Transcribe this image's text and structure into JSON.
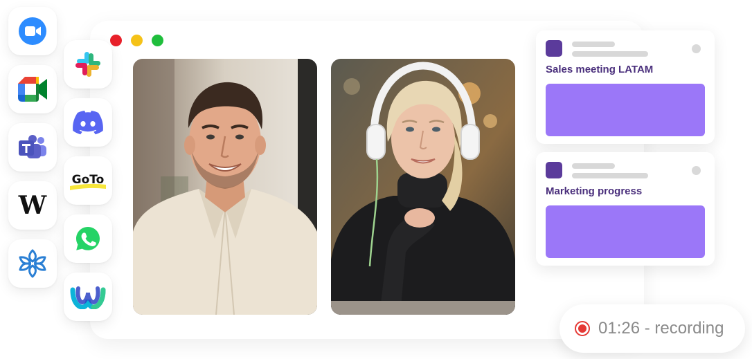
{
  "apps_left": [
    {
      "name": "Zoom",
      "icon": "zoom-icon",
      "color": "#2d8cff"
    },
    {
      "name": "Google Meet",
      "icon": "google-meet-icon",
      "color": "#00832d"
    },
    {
      "name": "Microsoft Teams",
      "icon": "microsoft-teams-icon",
      "color": "#5b5fc7"
    },
    {
      "name": "Webex Calling",
      "icon": "w-letter-icon",
      "color": "#111111"
    },
    {
      "name": "Zoho",
      "icon": "asterisk-icon",
      "color": "#2a7fd4"
    }
  ],
  "apps_right": [
    {
      "name": "Slack",
      "icon": "slack-icon",
      "color": "#e01e5a"
    },
    {
      "name": "Discord",
      "icon": "discord-icon",
      "color": "#5865f2"
    },
    {
      "name": "GoTo",
      "icon": "goto-icon",
      "label": "GoTo",
      "color": "#f7e63a"
    },
    {
      "name": "WhatsApp",
      "icon": "whatsapp-icon",
      "color": "#25d366"
    },
    {
      "name": "Webex",
      "icon": "webex-icon",
      "color": "#07a3c8"
    }
  ],
  "window": {
    "dots": [
      {
        "name": "close",
        "color": "#e8202a"
      },
      {
        "name": "minimize",
        "color": "#f5c218"
      },
      {
        "name": "maximize",
        "color": "#1fbe3c"
      }
    ]
  },
  "participants": [
    {
      "name": "man-in-linen-shirt"
    },
    {
      "name": "woman-with-headphones"
    }
  ],
  "meetings": [
    {
      "title": "Sales meeting LATAM",
      "color": "#9b77f8"
    },
    {
      "title": "Marketing progress",
      "color": "#9b77f8"
    }
  ],
  "recording": {
    "time": "01:26",
    "status_text": "01:26 - recording",
    "color": "#e53935"
  }
}
